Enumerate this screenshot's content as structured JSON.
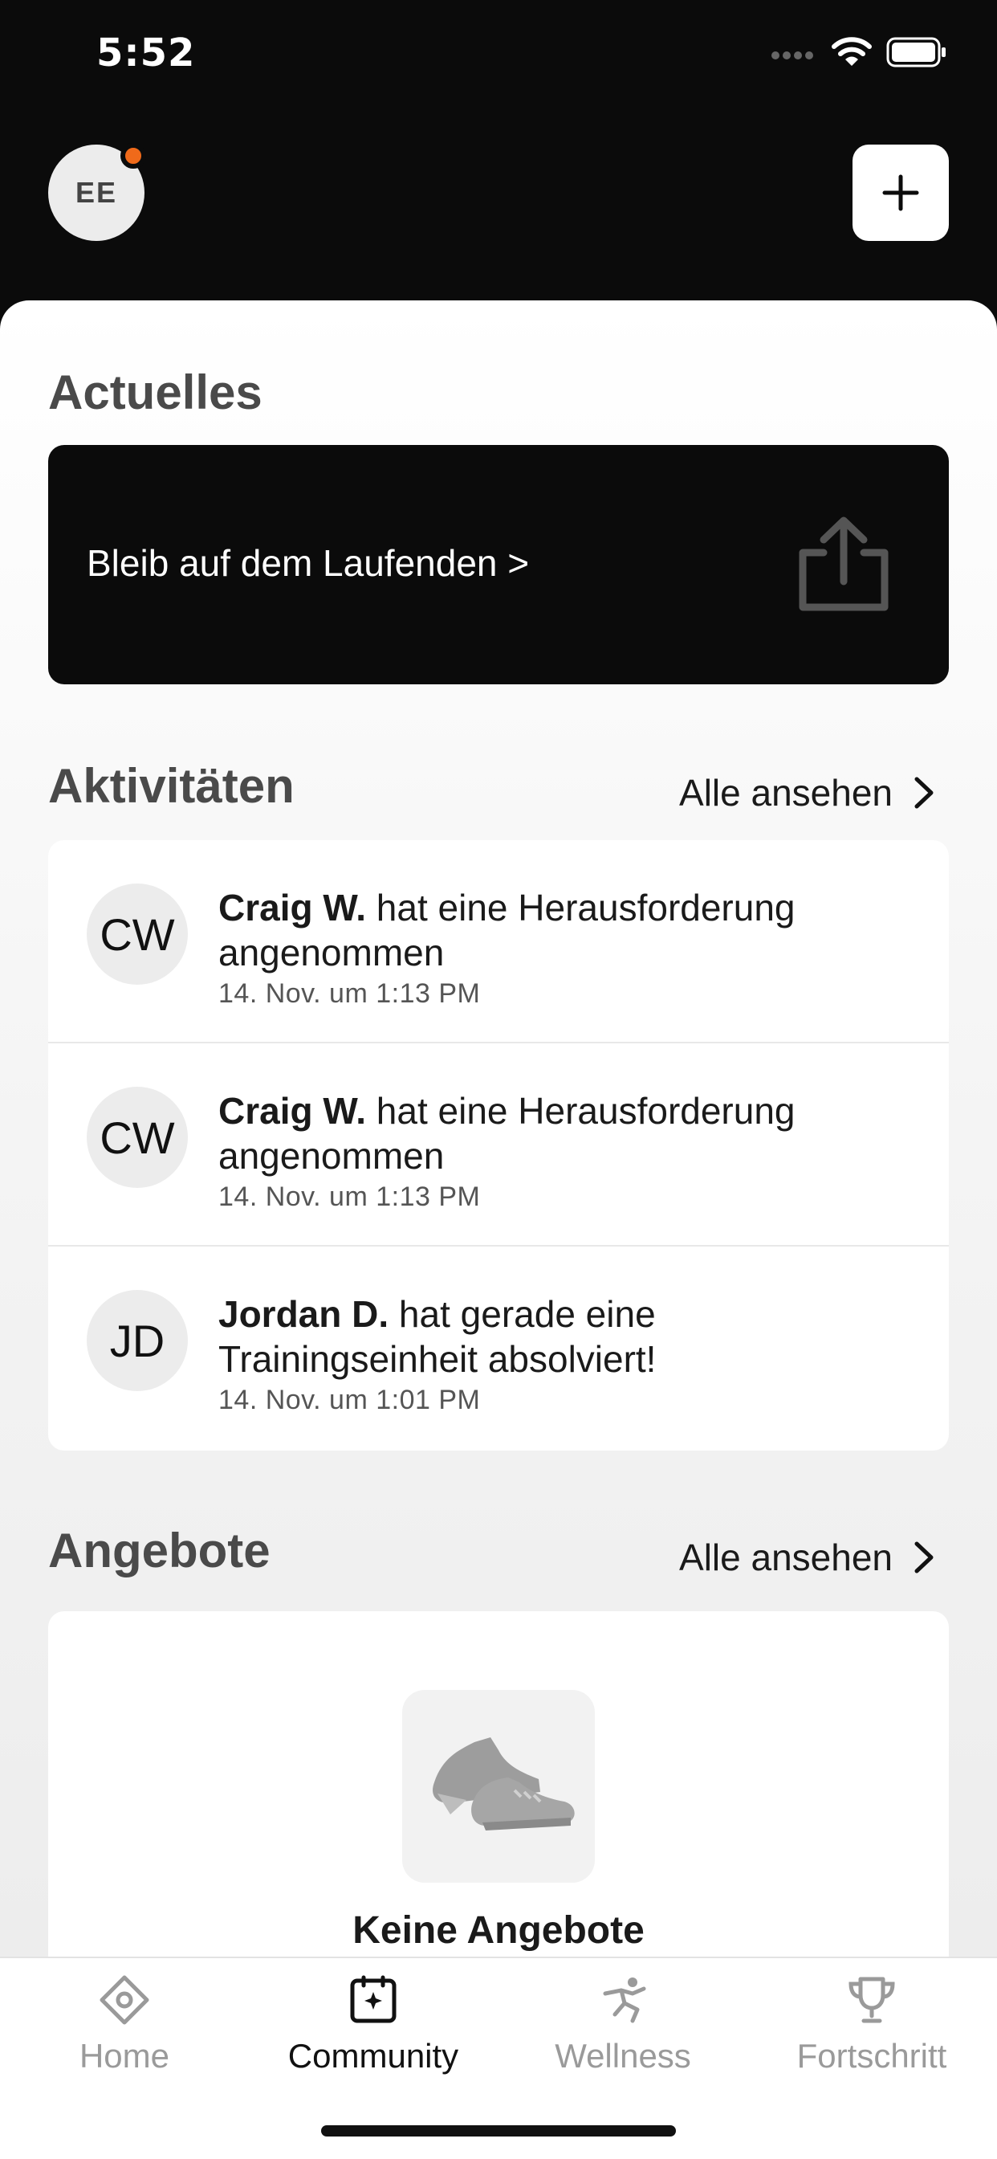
{
  "status_bar": {
    "time": "5:52"
  },
  "header": {
    "avatar_initials": "EE",
    "add_label": "+"
  },
  "news": {
    "title": "Actuelles",
    "card_text": "Bleib auf dem Laufenden >"
  },
  "activities": {
    "title": "Aktivitäten",
    "see_all": "Alle ansehen",
    "items": [
      {
        "initials": "CW",
        "name": "Craig W.",
        "text": " hat eine Herausforderung angenommen",
        "time": "14. Nov. um 1:13 PM"
      },
      {
        "initials": "CW",
        "name": "Craig W.",
        "text": " hat eine Herausforderung angenommen",
        "time": "14. Nov. um 1:13 PM"
      },
      {
        "initials": "JD",
        "name": "Jordan D.",
        "text": " hat gerade eine Trainingseinheit absolviert!",
        "time": "14. Nov. um 1:01 PM"
      }
    ]
  },
  "offers": {
    "title": "Angebote",
    "see_all": "Alle ansehen",
    "empty_text": "Keine Angebote"
  },
  "tabs": [
    {
      "label": "Home",
      "icon": "home-diamond-icon"
    },
    {
      "label": "Community",
      "icon": "community-icon",
      "active": true
    },
    {
      "label": "Wellness",
      "icon": "wellness-runner-icon"
    },
    {
      "label": "Fortschritt",
      "icon": "trophy-icon"
    }
  ],
  "colors": {
    "accent_dot": "#f06a1a",
    "header_bg": "#0b0b0b",
    "inactive_tab": "#9a9a9a"
  }
}
